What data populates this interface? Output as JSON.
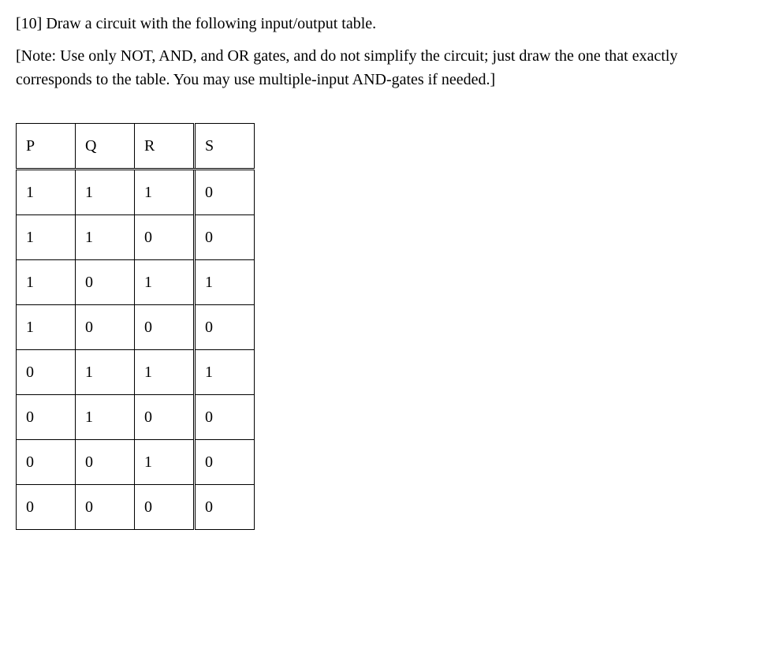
{
  "problem": {
    "number_label": "[10]",
    "prompt": "Draw a circuit with the following input/output table.",
    "note": "[Note: Use only NOT, AND, and OR gates, and do not simplify the circuit; just draw the one that exactly corresponds to the table. You may use multiple-input AND-gates if needed.]"
  },
  "table": {
    "headers": [
      "P",
      "Q",
      "R",
      "S"
    ],
    "input_cols": 3,
    "rows": [
      [
        "1",
        "1",
        "1",
        "0"
      ],
      [
        "1",
        "1",
        "0",
        "0"
      ],
      [
        "1",
        "0",
        "1",
        "1"
      ],
      [
        "1",
        "0",
        "0",
        "0"
      ],
      [
        "0",
        "1",
        "1",
        "1"
      ],
      [
        "0",
        "1",
        "0",
        "0"
      ],
      [
        "0",
        "0",
        "1",
        "0"
      ],
      [
        "0",
        "0",
        "0",
        "0"
      ]
    ]
  }
}
